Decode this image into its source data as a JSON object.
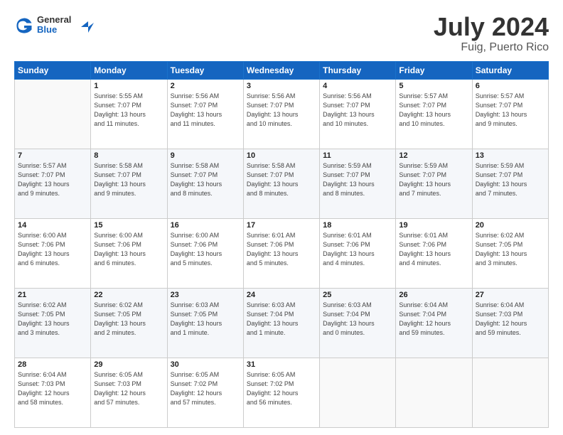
{
  "logo": {
    "general": "General",
    "blue": "Blue"
  },
  "title": "July 2024",
  "subtitle": "Fuig, Puerto Rico",
  "days_header": [
    "Sunday",
    "Monday",
    "Tuesday",
    "Wednesday",
    "Thursday",
    "Friday",
    "Saturday"
  ],
  "weeks": [
    [
      {
        "num": "",
        "info": ""
      },
      {
        "num": "1",
        "info": "Sunrise: 5:55 AM\nSunset: 7:07 PM\nDaylight: 13 hours\nand 11 minutes."
      },
      {
        "num": "2",
        "info": "Sunrise: 5:56 AM\nSunset: 7:07 PM\nDaylight: 13 hours\nand 11 minutes."
      },
      {
        "num": "3",
        "info": "Sunrise: 5:56 AM\nSunset: 7:07 PM\nDaylight: 13 hours\nand 10 minutes."
      },
      {
        "num": "4",
        "info": "Sunrise: 5:56 AM\nSunset: 7:07 PM\nDaylight: 13 hours\nand 10 minutes."
      },
      {
        "num": "5",
        "info": "Sunrise: 5:57 AM\nSunset: 7:07 PM\nDaylight: 13 hours\nand 10 minutes."
      },
      {
        "num": "6",
        "info": "Sunrise: 5:57 AM\nSunset: 7:07 PM\nDaylight: 13 hours\nand 9 minutes."
      }
    ],
    [
      {
        "num": "7",
        "info": "Sunrise: 5:57 AM\nSunset: 7:07 PM\nDaylight: 13 hours\nand 9 minutes."
      },
      {
        "num": "8",
        "info": "Sunrise: 5:58 AM\nSunset: 7:07 PM\nDaylight: 13 hours\nand 9 minutes."
      },
      {
        "num": "9",
        "info": "Sunrise: 5:58 AM\nSunset: 7:07 PM\nDaylight: 13 hours\nand 8 minutes."
      },
      {
        "num": "10",
        "info": "Sunrise: 5:58 AM\nSunset: 7:07 PM\nDaylight: 13 hours\nand 8 minutes."
      },
      {
        "num": "11",
        "info": "Sunrise: 5:59 AM\nSunset: 7:07 PM\nDaylight: 13 hours\nand 8 minutes."
      },
      {
        "num": "12",
        "info": "Sunrise: 5:59 AM\nSunset: 7:07 PM\nDaylight: 13 hours\nand 7 minutes."
      },
      {
        "num": "13",
        "info": "Sunrise: 5:59 AM\nSunset: 7:07 PM\nDaylight: 13 hours\nand 7 minutes."
      }
    ],
    [
      {
        "num": "14",
        "info": "Sunrise: 6:00 AM\nSunset: 7:06 PM\nDaylight: 13 hours\nand 6 minutes."
      },
      {
        "num": "15",
        "info": "Sunrise: 6:00 AM\nSunset: 7:06 PM\nDaylight: 13 hours\nand 6 minutes."
      },
      {
        "num": "16",
        "info": "Sunrise: 6:00 AM\nSunset: 7:06 PM\nDaylight: 13 hours\nand 5 minutes."
      },
      {
        "num": "17",
        "info": "Sunrise: 6:01 AM\nSunset: 7:06 PM\nDaylight: 13 hours\nand 5 minutes."
      },
      {
        "num": "18",
        "info": "Sunrise: 6:01 AM\nSunset: 7:06 PM\nDaylight: 13 hours\nand 4 minutes."
      },
      {
        "num": "19",
        "info": "Sunrise: 6:01 AM\nSunset: 7:06 PM\nDaylight: 13 hours\nand 4 minutes."
      },
      {
        "num": "20",
        "info": "Sunrise: 6:02 AM\nSunset: 7:05 PM\nDaylight: 13 hours\nand 3 minutes."
      }
    ],
    [
      {
        "num": "21",
        "info": "Sunrise: 6:02 AM\nSunset: 7:05 PM\nDaylight: 13 hours\nand 3 minutes."
      },
      {
        "num": "22",
        "info": "Sunrise: 6:02 AM\nSunset: 7:05 PM\nDaylight: 13 hours\nand 2 minutes."
      },
      {
        "num": "23",
        "info": "Sunrise: 6:03 AM\nSunset: 7:05 PM\nDaylight: 13 hours\nand 1 minute."
      },
      {
        "num": "24",
        "info": "Sunrise: 6:03 AM\nSunset: 7:04 PM\nDaylight: 13 hours\nand 1 minute."
      },
      {
        "num": "25",
        "info": "Sunrise: 6:03 AM\nSunset: 7:04 PM\nDaylight: 13 hours\nand 0 minutes."
      },
      {
        "num": "26",
        "info": "Sunrise: 6:04 AM\nSunset: 7:04 PM\nDaylight: 12 hours\nand 59 minutes."
      },
      {
        "num": "27",
        "info": "Sunrise: 6:04 AM\nSunset: 7:03 PM\nDaylight: 12 hours\nand 59 minutes."
      }
    ],
    [
      {
        "num": "28",
        "info": "Sunrise: 6:04 AM\nSunset: 7:03 PM\nDaylight: 12 hours\nand 58 minutes."
      },
      {
        "num": "29",
        "info": "Sunrise: 6:05 AM\nSunset: 7:03 PM\nDaylight: 12 hours\nand 57 minutes."
      },
      {
        "num": "30",
        "info": "Sunrise: 6:05 AM\nSunset: 7:02 PM\nDaylight: 12 hours\nand 57 minutes."
      },
      {
        "num": "31",
        "info": "Sunrise: 6:05 AM\nSunset: 7:02 PM\nDaylight: 12 hours\nand 56 minutes."
      },
      {
        "num": "",
        "info": ""
      },
      {
        "num": "",
        "info": ""
      },
      {
        "num": "",
        "info": ""
      }
    ]
  ]
}
